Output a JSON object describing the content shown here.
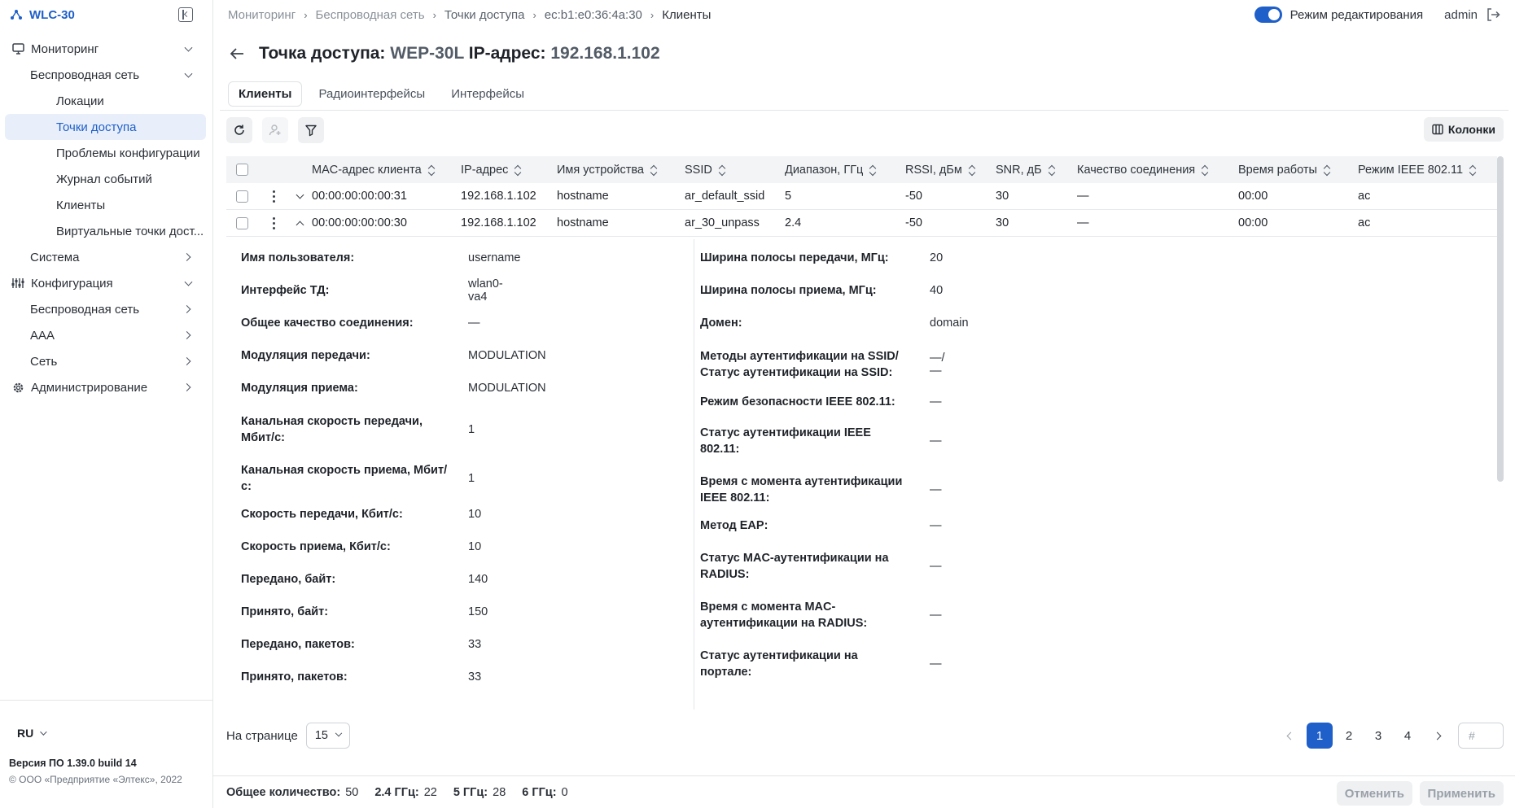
{
  "brand": {
    "name": "WLC-30"
  },
  "sidebar": {
    "items": [
      {
        "label": "Мониторинг"
      },
      {
        "label": "Беспроводная сеть"
      },
      {
        "label": "Локации"
      },
      {
        "label": "Точки доступа"
      },
      {
        "label": "Проблемы конфигурации"
      },
      {
        "label": "Журнал событий"
      },
      {
        "label": "Клиенты"
      },
      {
        "label": "Виртуальные точки дост..."
      },
      {
        "label": "Система"
      },
      {
        "label": "Конфигурация"
      },
      {
        "label": "Беспроводная сеть"
      },
      {
        "label": "AAA"
      },
      {
        "label": "Сеть"
      },
      {
        "label": "Администрирование"
      }
    ],
    "lang": "RU",
    "version": "Версия ПО 1.39.0 build 14",
    "copyright": "© ООО «Предприятие «Элтекс», 2022"
  },
  "breadcrumbs": [
    "Мониторинг",
    "Беспроводная сеть",
    "Точки доступа",
    "ec:b1:e0:36:4a:30",
    "Клиенты"
  ],
  "topbar": {
    "edit_mode": "Режим редактирования",
    "user": "admin"
  },
  "title": {
    "prefix": "Точка доступа:",
    "ap": "WEP-30L",
    "ip_label": "IP-адрес:",
    "ip": "192.168.1.102"
  },
  "tabs": [
    "Клиенты",
    "Радиоинтерфейсы",
    "Интерфейсы"
  ],
  "toolbar": {
    "columns": "Колонки"
  },
  "table": {
    "headers": [
      "MAC-адрес клиента",
      "IP-адрес",
      "Имя устройства",
      "SSID",
      "Диапазон, ГГц",
      "RSSI, дБм",
      "SNR, дБ",
      "Качество соединения",
      "Время работы",
      "Режим IEEE 802.11"
    ],
    "rows": [
      [
        "00:00:00:00:00:31",
        "192.168.1.102",
        "hostname",
        "ar_default_ssid",
        "5",
        "-50",
        "30",
        "—",
        "00:00",
        "ac"
      ],
      [
        "00:00:00:00:00:30",
        "192.168.1.102",
        "hostname",
        "ar_30_unpass",
        "2.4",
        "-50",
        "30",
        "—",
        "00:00",
        "ac"
      ]
    ]
  },
  "details": {
    "left": [
      {
        "label": "Имя пользователя:",
        "value": "username"
      },
      {
        "label": "Интерфейс ТД:",
        "value": "wlan0-va4"
      },
      {
        "label": "Общее качество соединения:",
        "value": "—"
      },
      {
        "label": "Модуляция передачи:",
        "value": "MODULATION"
      },
      {
        "label": "Модуляция приема:",
        "value": "MODULATION"
      },
      {
        "label": "Канальная скорость передачи, Мбит/с:",
        "value": "1"
      },
      {
        "label": "Канальная скорость приема, Мбит/с:",
        "value": "1"
      },
      {
        "label": "Скорость передачи, Кбит/с:",
        "value": "10"
      },
      {
        "label": "Скорость приема, Кбит/с:",
        "value": "10"
      },
      {
        "label": "Передано, байт:",
        "value": "140"
      },
      {
        "label": "Принято, байт:",
        "value": "150"
      },
      {
        "label": "Передано, пакетов:",
        "value": "33"
      },
      {
        "label": "Принято, пакетов:",
        "value": "33"
      }
    ],
    "right": [
      {
        "label": "Ширина полосы передачи, МГц:",
        "value": "20"
      },
      {
        "label": "Ширина полосы приема, МГц:",
        "value": "40"
      },
      {
        "label": "Домен:",
        "value": "domain"
      },
      {
        "label": "Методы аутентификации на SSID/ Статус аутентификации на SSID:",
        "value": "—/—"
      },
      {
        "label": "Режим безопасности IEEE 802.11:",
        "value": "—"
      },
      {
        "label": "Статус аутентификации IEEE 802.11:",
        "value": "—"
      },
      {
        "label": "Время с момента аутентификации IEEE 802.11:",
        "value": "—"
      },
      {
        "label": "Метод EAP:",
        "value": "—"
      },
      {
        "label": "Статус MAC-аутентификации на RADIUS:",
        "value": "—"
      },
      {
        "label": "Время с момента MAC-аутентификации на RADIUS:",
        "value": "—"
      },
      {
        "label": "Статус аутентификации на портале:",
        "value": "—"
      }
    ]
  },
  "pagination": {
    "per_page_label": "На странице",
    "per_page": "15",
    "pages": [
      "1",
      "2",
      "3",
      "4"
    ],
    "current": "1",
    "jump_placeholder": "#"
  },
  "footer": {
    "total_label": "Общее количество:",
    "total": "50",
    "g24_label": "2.4 ГГц:",
    "g24": "22",
    "g5_label": "5 ГГц:",
    "g5": "28",
    "g6_label": "6 ГГц:",
    "g6": "0",
    "cancel": "Отменить",
    "apply": "Применить"
  },
  "colors": {
    "accent": "#1f5fc9",
    "active_bg": "#e8effb"
  }
}
